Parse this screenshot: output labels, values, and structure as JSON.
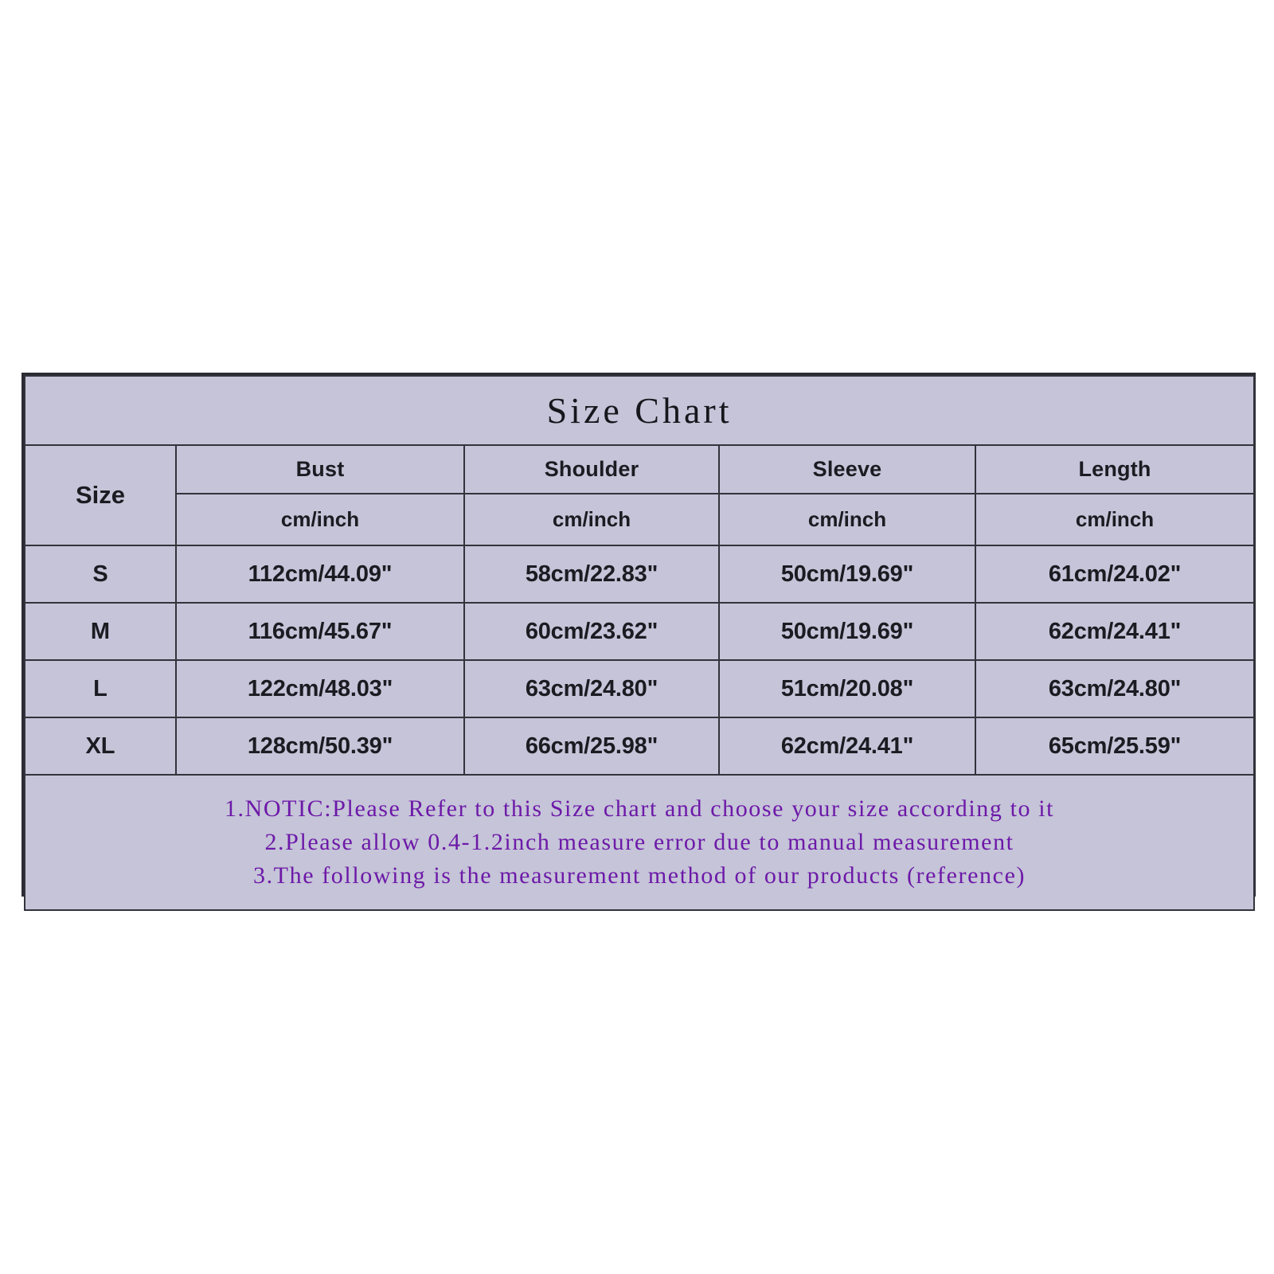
{
  "title": "Size Chart",
  "table": {
    "size_header": "Size",
    "columns": [
      {
        "name": "Bust",
        "unit": "cm/inch"
      },
      {
        "name": "Shoulder",
        "unit": "cm/inch"
      },
      {
        "name": "Sleeve",
        "unit": "cm/inch"
      },
      {
        "name": "Length",
        "unit": "cm/inch"
      }
    ],
    "rows": [
      {
        "size": "S",
        "bust": "112cm/44.09\"",
        "shoulder": "58cm/22.83\"",
        "sleeve": "50cm/19.69\"",
        "length": "61cm/24.02\""
      },
      {
        "size": "M",
        "bust": "116cm/45.67\"",
        "shoulder": "60cm/23.62\"",
        "sleeve": "50cm/19.69\"",
        "length": "62cm/24.41\""
      },
      {
        "size": "L",
        "bust": "122cm/48.03\"",
        "shoulder": "63cm/24.80\"",
        "sleeve": "51cm/20.08\"",
        "length": "63cm/24.80\""
      },
      {
        "size": "XL",
        "bust": "128cm/50.39\"",
        "shoulder": "66cm/25.98\"",
        "sleeve": "62cm/24.41\"",
        "length": "65cm/25.59\""
      }
    ]
  },
  "notes": [
    "1.NOTIC:Please Refer to this Size chart and choose your size according to it",
    "2.Please allow 0.4-1.2inch measure error due to manual measurement",
    "3.The following is the measurement method of our products (reference)"
  ],
  "colors": {
    "cell_background": "#c5c4d8",
    "border": "#33333d",
    "note_text": "#6d19a8",
    "page_background": "#ffffff"
  },
  "chart_data": {
    "type": "table",
    "title": "Size Chart",
    "columns": [
      "Size",
      "Bust cm/inch",
      "Shoulder cm/inch",
      "Sleeve cm/inch",
      "Length cm/inch"
    ],
    "rows": [
      [
        "S",
        "112cm/44.09\"",
        "58cm/22.83\"",
        "50cm/19.69\"",
        "61cm/24.02\""
      ],
      [
        "M",
        "116cm/45.67\"",
        "60cm/23.62\"",
        "50cm/19.69\"",
        "62cm/24.41\""
      ],
      [
        "L",
        "122cm/48.03\"",
        "63cm/24.80\"",
        "51cm/20.08\"",
        "63cm/24.80\""
      ],
      [
        "XL",
        "128cm/50.39\"",
        "66cm/25.98\"",
        "62cm/24.41\"",
        "65cm/25.59\""
      ]
    ],
    "units": "cm/inch",
    "bust_cm": [
      112,
      116,
      122,
      128
    ],
    "bust_inch": [
      44.09,
      45.67,
      48.03,
      50.39
    ],
    "shoulder_cm": [
      58,
      60,
      63,
      66
    ],
    "shoulder_inch": [
      22.83,
      23.62,
      24.8,
      25.98
    ],
    "sleeve_cm": [
      50,
      50,
      51,
      62
    ],
    "sleeve_inch": [
      19.69,
      19.69,
      20.08,
      24.41
    ],
    "length_cm": [
      61,
      62,
      63,
      65
    ],
    "length_inch": [
      24.02,
      24.41,
      24.8,
      25.59
    ]
  }
}
